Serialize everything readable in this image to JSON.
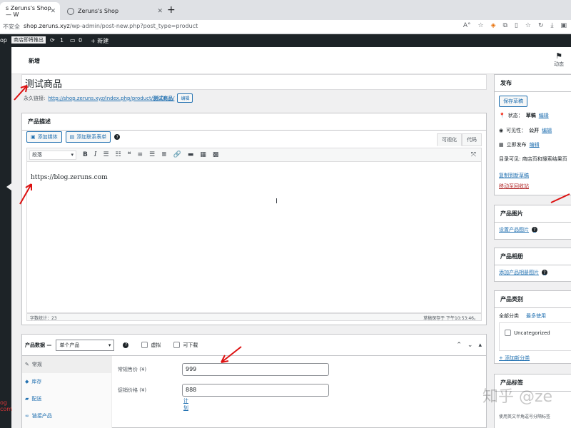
{
  "browser": {
    "tabs": [
      {
        "title": "s Zeruns's Shop — W"
      },
      {
        "title": "Zeruns's Shop"
      }
    ],
    "new_tab": "+",
    "insecure_label": "不安全",
    "url_host": "shop.zeruns.xyz",
    "url_path": "/wp-admin/post-new.php?post_type=product"
  },
  "admin_bar": {
    "site": "op",
    "coming_soon": "商店即将推出",
    "updates": "1",
    "comments": "0",
    "new_label": "+ 新建"
  },
  "header": {
    "title": "新增",
    "activity": "动态"
  },
  "post": {
    "title": "测试商品",
    "permalink_label": "永久链接:",
    "permalink_url": "http://shop.zeruns.xyz/index.php/product/",
    "permalink_slug": "测试商品",
    "permalink_tail": "/",
    "edit_label": "编辑"
  },
  "description": {
    "title": "产品描述",
    "add_media": "添加媒体",
    "add_contact_form": "添加联系表单",
    "tab_visual": "可视化",
    "tab_code": "代码",
    "format_select": "段落",
    "content": "https://blog.zeruns.com",
    "word_count": "字数统计：23",
    "saved_at": "草稿保存于 下午10:53:46。"
  },
  "product_data": {
    "label": "产品数据 —",
    "type": "单个产品",
    "virtual": "虚拟",
    "downloadable": "可下载",
    "nav": [
      "常规",
      "库存",
      "配送",
      "链接产品"
    ],
    "regular_price_label": "常规售价 (¥)",
    "regular_price": "999",
    "sale_price_label": "促销价格 (¥)",
    "sale_price": "888",
    "schedule": "计划"
  },
  "publish": {
    "title": "发布",
    "save_draft": "保存草稿",
    "status_label": "状态：",
    "status_value": "草稿",
    "visibility_label": "可见性：",
    "visibility_value": "公开",
    "publish_label": "立即发布",
    "edit": "编辑",
    "catalog": "目录可见: 商店页和搜索结果页",
    "copy_draft": "复制到新草稿",
    "trash": "移动至回收站"
  },
  "product_image": {
    "title": "产品图片",
    "set": "设置产品图片"
  },
  "gallery": {
    "title": "产品相册",
    "add": "添加产品相册图片"
  },
  "categories": {
    "title": "产品类别",
    "all": "全部分类",
    "most_used": "最多使用",
    "uncategorized": "Uncategorized",
    "add_new": "+ 添加新分类"
  },
  "tags": {
    "title": "产品标签",
    "hint": "使用英文半角逗号分隔标签"
  },
  "sidebar_text": {
    "line1": "og",
    "line2": "com"
  },
  "watermark": "知乎 @ze"
}
